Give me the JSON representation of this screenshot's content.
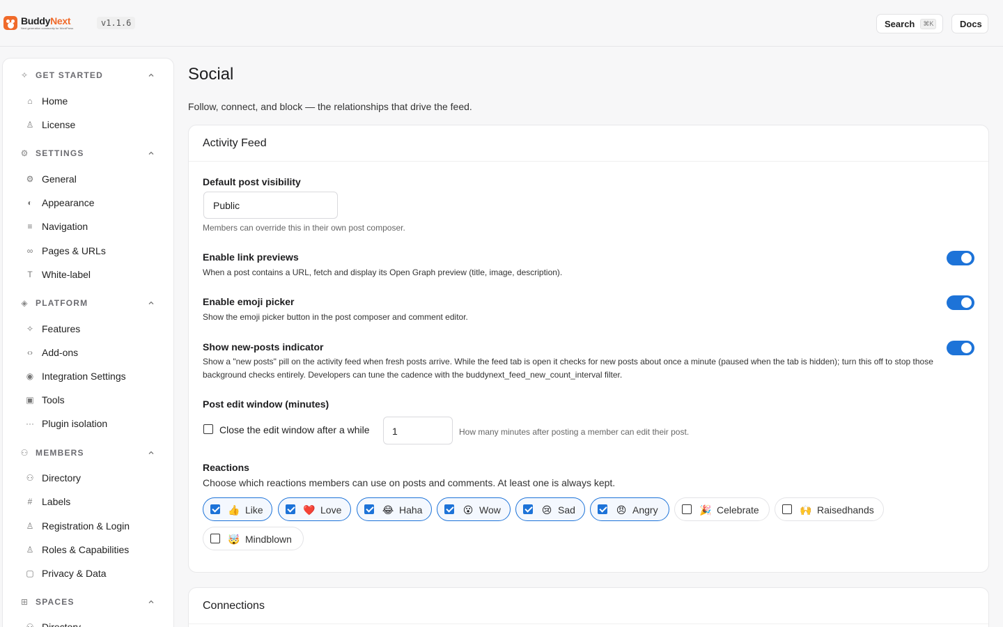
{
  "brand": {
    "name_part1": "Buddy",
    "name_part2": "Next",
    "tagline": "Next generation community for WordPress",
    "version": "v1.1.6"
  },
  "topbar": {
    "search_label": "Search",
    "search_shortcut": "⌘K",
    "docs_label": "Docs"
  },
  "sidebar": {
    "sections": [
      {
        "label": "GET STARTED",
        "items": [
          "Home",
          "License"
        ]
      },
      {
        "label": "SETTINGS",
        "items": [
          "General",
          "Appearance",
          "Navigation",
          "Pages & URLs",
          "White-label"
        ]
      },
      {
        "label": "PLATFORM",
        "items": [
          "Features",
          "Add-ons",
          "Integration Settings",
          "Tools",
          "Plugin isolation"
        ]
      },
      {
        "label": "MEMBERS",
        "items": [
          "Directory",
          "Labels",
          "Registration & Login",
          "Roles & Capabilities",
          "Privacy & Data"
        ]
      },
      {
        "label": "SPACES",
        "items": [
          "Directory"
        ]
      }
    ]
  },
  "page": {
    "title": "Social",
    "subtitle": "Follow, connect, and block — the relationships that drive the feed."
  },
  "activity_feed": {
    "title": "Activity Feed",
    "visibility_label": "Default post visibility",
    "visibility_value": "Public",
    "visibility_help": "Members can override this in their own post composer.",
    "toggles": [
      {
        "label": "Enable link previews",
        "desc": "When a post contains a URL, fetch and display its Open Graph preview (title, image, description).",
        "on": true
      },
      {
        "label": "Enable emoji picker",
        "desc": "Show the emoji picker button in the post composer and comment editor.",
        "on": true
      },
      {
        "label": "Show new-posts indicator",
        "desc": "Show a \"new posts\" pill on the activity feed when fresh posts arrive. While the feed tab is open it checks for new posts about once a minute (paused when the tab is hidden); turn this off to stop those background checks entirely. Developers can tune the cadence with the buddynext_feed_new_count_interval filter.",
        "on": true
      }
    ],
    "edit_window_label": "Post edit window (minutes)",
    "edit_window_checkbox": "Close the edit window after a while",
    "edit_window_value": "1",
    "edit_window_help": "How many minutes after posting a member can edit their post.",
    "reactions_label": "Reactions",
    "reactions_desc": "Choose which reactions members can use on posts and comments. At least one is always kept.",
    "reactions": [
      {
        "label": "Like",
        "emoji": "👍",
        "checked": true
      },
      {
        "label": "Love",
        "emoji": "❤️",
        "checked": true
      },
      {
        "label": "Haha",
        "emoji": "😂",
        "checked": true
      },
      {
        "label": "Wow",
        "emoji": "😮",
        "checked": true
      },
      {
        "label": "Sad",
        "emoji": "😢",
        "checked": true
      },
      {
        "label": "Angry",
        "emoji": "😠",
        "checked": true
      },
      {
        "label": "Celebrate",
        "emoji": "🎉",
        "checked": false
      },
      {
        "label": "Raisedhands",
        "emoji": "🙌",
        "checked": false
      },
      {
        "label": "Mindblown",
        "emoji": "🤯",
        "checked": false
      }
    ]
  },
  "connections": {
    "title": "Connections"
  },
  "colors": {
    "accent": "#1d73d8",
    "brand": "#f06a2a"
  }
}
